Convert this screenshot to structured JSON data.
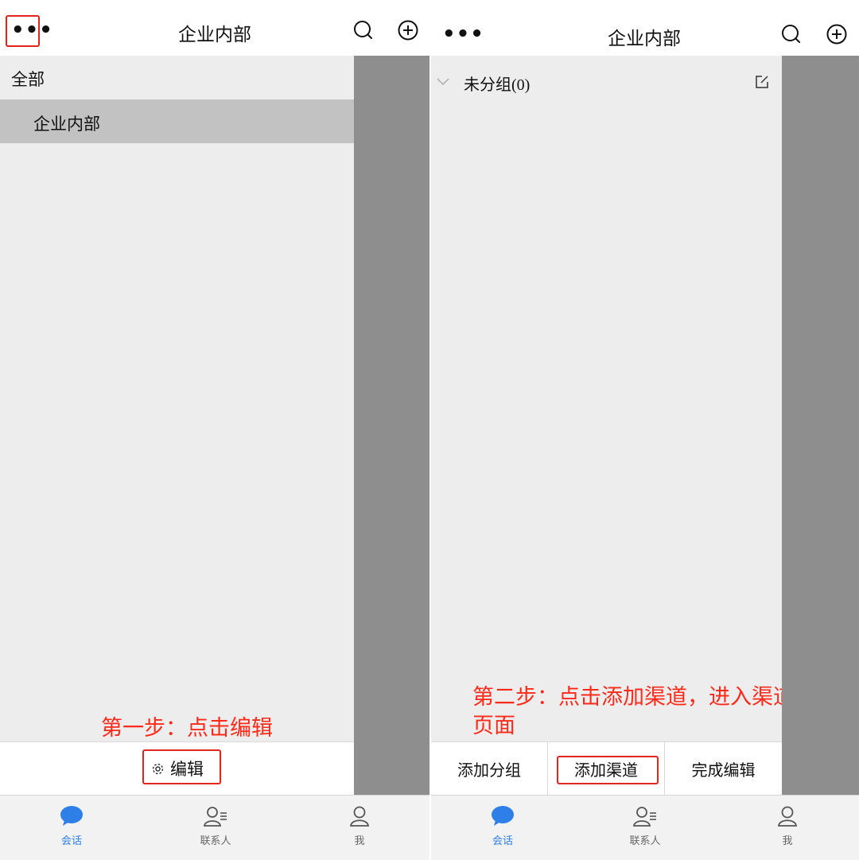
{
  "left": {
    "header": {
      "more_label": "•••",
      "title": "企业内部"
    },
    "menu": {
      "all_label": "全部",
      "selected_item": "企业内部"
    },
    "edit_button": {
      "label": "编辑"
    },
    "annotation": "第一步：点击编辑",
    "tabs": [
      {
        "label": "会话",
        "icon": "chat-bubble-icon",
        "active": true
      },
      {
        "label": "联系人",
        "icon": "contacts-icon",
        "active": false
      },
      {
        "label": "我",
        "icon": "person-icon",
        "active": false
      }
    ]
  },
  "right": {
    "header": {
      "more_label": "•••",
      "title": "企业内部"
    },
    "group": {
      "label": "未分组(0)"
    },
    "buttons": {
      "add_group": "添加分组",
      "add_channel": "添加渠道",
      "finish_edit": "完成编辑"
    },
    "annotation_line1": "第二步：点击添加渠道，进入渠道编辑",
    "annotation_line2": "页面",
    "tabs": [
      {
        "label": "会话",
        "icon": "chat-bubble-icon",
        "active": true
      },
      {
        "label": "联系人",
        "icon": "contacts-icon",
        "active": false
      },
      {
        "label": "我",
        "icon": "person-icon",
        "active": false
      }
    ]
  },
  "colors": {
    "accent_blue": "#2f7fe8",
    "annotation_red": "#ff2a1a",
    "overlay_gray": "#8e8e8e",
    "drawer_bg": "#ededed"
  }
}
